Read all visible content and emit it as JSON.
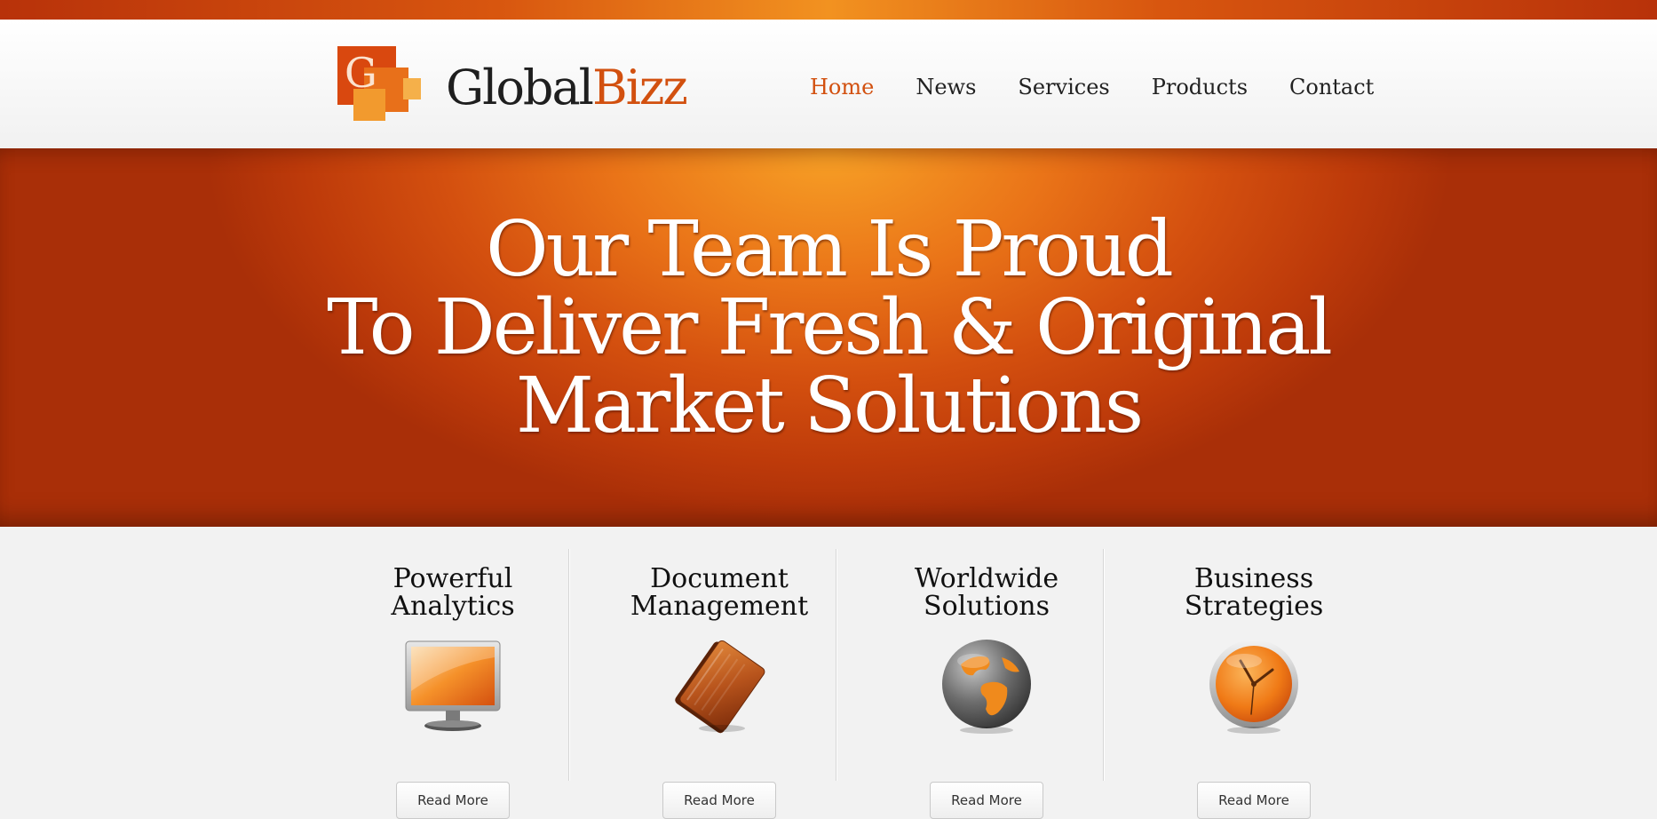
{
  "brand": {
    "name_part1": "Global",
    "name_part2": "Bizz",
    "mark_letter": "G"
  },
  "nav": {
    "items": [
      {
        "label": "Home",
        "active": true
      },
      {
        "label": "News",
        "active": false
      },
      {
        "label": "Services",
        "active": false
      },
      {
        "label": "Products",
        "active": false
      },
      {
        "label": "Contact",
        "active": false
      }
    ]
  },
  "hero": {
    "lines": [
      "Our Team Is Proud",
      "To Deliver Fresh & Original",
      "Market Solutions"
    ]
  },
  "features": [
    {
      "title_line1": "Powerful",
      "title_line2": "Analytics",
      "icon": "monitor-icon",
      "button": "Read More"
    },
    {
      "title_line1": "Document",
      "title_line2": "Management",
      "icon": "folder-icon",
      "button": "Read More"
    },
    {
      "title_line1": "Worldwide",
      "title_line2": "Solutions",
      "icon": "globe-icon",
      "button": "Read More"
    },
    {
      "title_line1": "Business",
      "title_line2": "Strategies",
      "icon": "clock-icon",
      "button": "Read More"
    }
  ],
  "colors": {
    "accent": "#d2500f",
    "accent_light": "#f29220",
    "text_dark": "#1e1e1e",
    "background": "#f2f2f2"
  }
}
